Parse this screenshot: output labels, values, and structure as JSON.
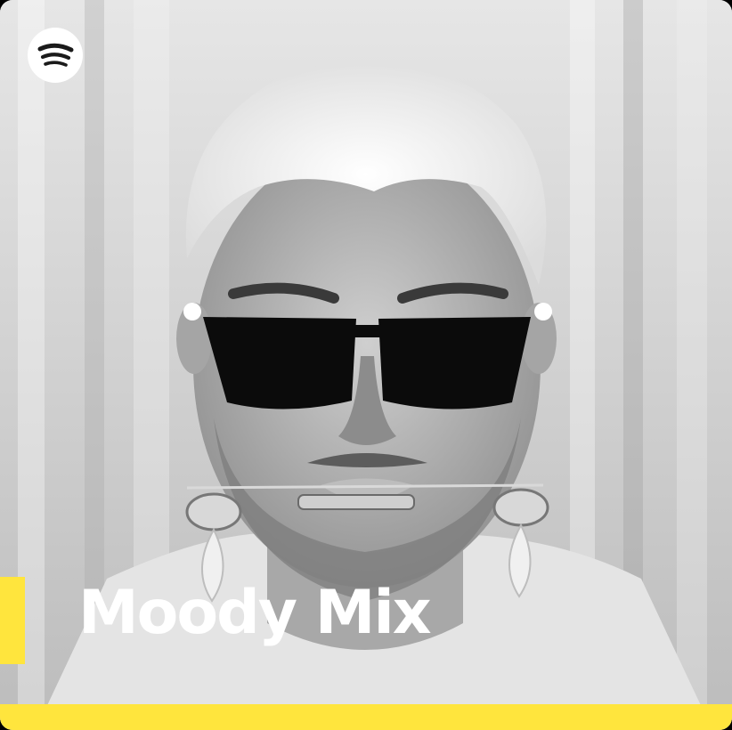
{
  "playlist": {
    "title": "Moody Mix"
  },
  "branding": {
    "logo": "spotify-icon"
  },
  "colors": {
    "accent": "#ffe53d",
    "title_text": "#ffffff",
    "logo_bg": "#ffffff",
    "logo_fg": "#1a1a1a",
    "photo_bg": "#d6d6d6"
  }
}
